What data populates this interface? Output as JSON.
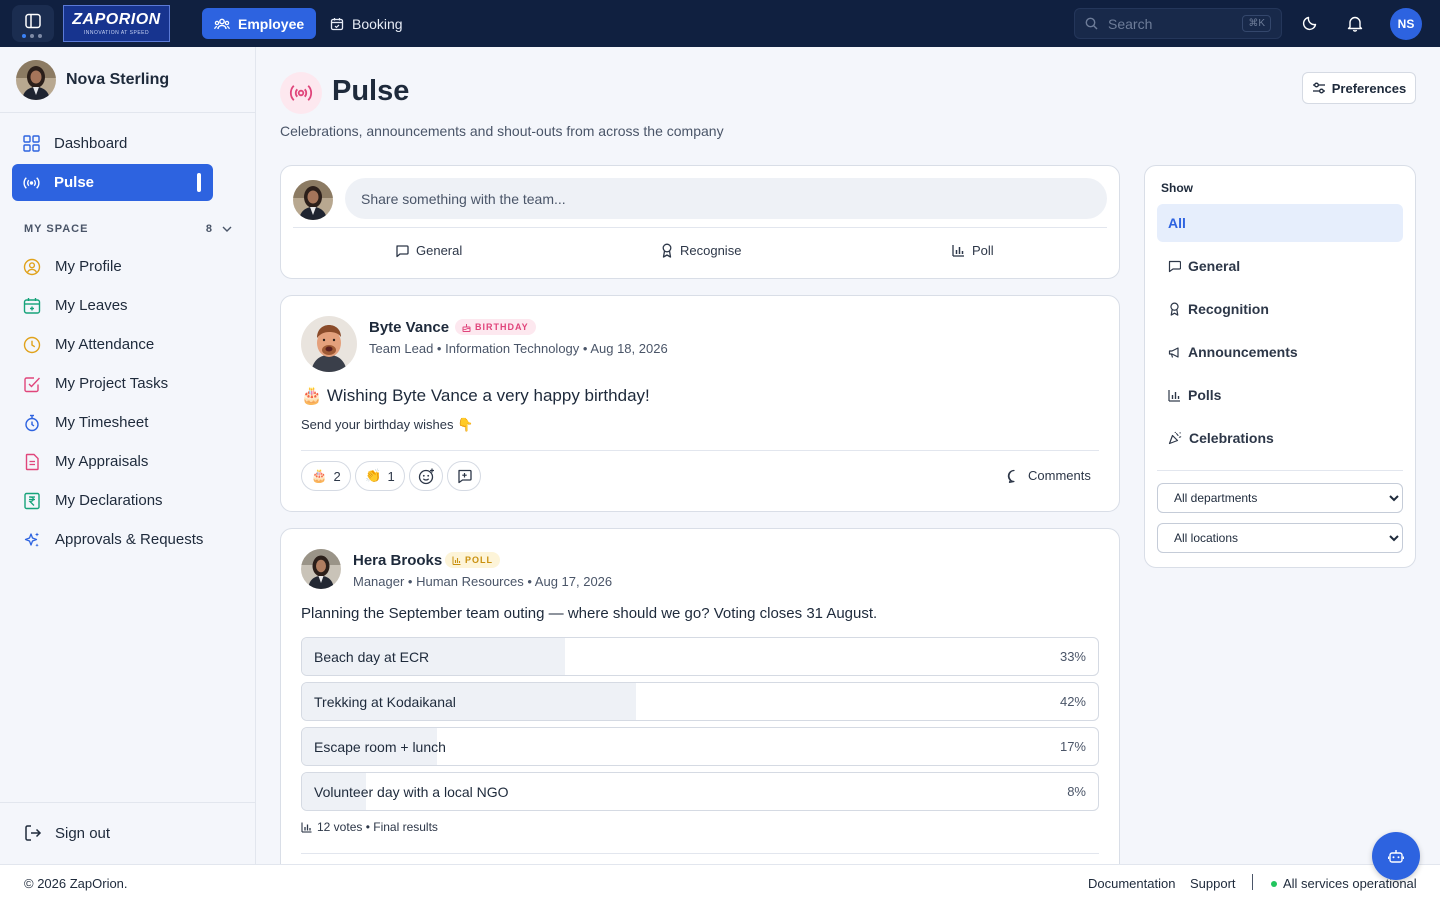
{
  "app": {
    "logo_text": "ZAPORION",
    "logo_tagline": "INNOVATION AT SPEED"
  },
  "topnav": {
    "tabs": [
      {
        "label": "Employee",
        "active": true,
        "icon": "users-icon"
      },
      {
        "label": "Booking",
        "active": false,
        "icon": "calendar-check-icon"
      }
    ],
    "search_placeholder": "Search",
    "search_shortcut": "⌘K",
    "user_initials": "NS"
  },
  "sidebar": {
    "user_name": "Nova Sterling",
    "top_items": [
      {
        "label": "Dashboard",
        "icon": "dashboard-icon",
        "active": false
      },
      {
        "label": "Pulse",
        "icon": "broadcast-icon",
        "active": true
      }
    ],
    "section_label": "MY SPACE",
    "section_count": "8",
    "items": [
      {
        "label": "My Profile",
        "icon": "user-circle-icon",
        "color": "#e0a21b"
      },
      {
        "label": "My Leaves",
        "icon": "calendar-plus-icon",
        "color": "#16a37a"
      },
      {
        "label": "My Attendance",
        "icon": "clock-icon",
        "color": "#e0a21b"
      },
      {
        "label": "My Project Tasks",
        "icon": "task-check-icon",
        "color": "#e0457b"
      },
      {
        "label": "My Timesheet",
        "icon": "stopwatch-icon",
        "color": "#2d63e0"
      },
      {
        "label": "My Appraisals",
        "icon": "document-icon",
        "color": "#e0457b"
      },
      {
        "label": "My Declarations",
        "icon": "rupee-icon",
        "color": "#16a37a"
      },
      {
        "label": "Approvals & Requests",
        "icon": "sparkles-icon",
        "color": "#2d63e0"
      }
    ],
    "signout_label": "Sign out"
  },
  "page": {
    "title": "Pulse",
    "subtitle": "Celebrations, announcements and shout-outs from across the company",
    "preferences_label": "Preferences"
  },
  "composer": {
    "placeholder": "Share something with the team...",
    "actions": [
      {
        "label": "General",
        "icon": "chat-icon"
      },
      {
        "label": "Recognise",
        "icon": "award-icon"
      },
      {
        "label": "Poll",
        "icon": "bar-chart-icon"
      }
    ]
  },
  "posts": [
    {
      "author": "Byte Vance",
      "badge": "BIRTHDAY",
      "meta": "Team Lead • Information Technology • Aug 18, 2026",
      "headline": "🎂 Wishing Byte Vance a very happy birthday!",
      "body": "Send your birthday wishes 👇",
      "reactions": [
        {
          "emoji": "🎂",
          "count": "2"
        },
        {
          "emoji": "👏",
          "count": "1"
        }
      ],
      "comments_label": "Comments"
    },
    {
      "author": "Hera Brooks",
      "badge": "POLL",
      "meta": "Manager • Human Resources • Aug 17, 2026",
      "question": "Planning the September team outing — where should we go? Voting closes 31 August.",
      "options": [
        {
          "label": "Beach day at ECR",
          "pct": "33%",
          "value": 33
        },
        {
          "label": "Trekking at Kodaikanal",
          "pct": "42%",
          "value": 42
        },
        {
          "label": "Escape room + lunch",
          "pct": "17%",
          "value": 17
        },
        {
          "label": "Volunteer day with a local NGO",
          "pct": "8%",
          "value": 8
        }
      ],
      "footer": "12 votes • Final results"
    }
  ],
  "filter": {
    "title": "Show",
    "items": [
      {
        "label": "All",
        "icon": "",
        "active": true
      },
      {
        "label": "General",
        "icon": "chat-icon",
        "active": false
      },
      {
        "label": "Recognition",
        "icon": "award-icon",
        "active": false
      },
      {
        "label": "Announcements",
        "icon": "megaphone-icon",
        "active": false
      },
      {
        "label": "Polls",
        "icon": "bar-chart-icon",
        "active": false
      },
      {
        "label": "Celebrations",
        "icon": "party-icon",
        "active": false
      }
    ],
    "department": "All departments",
    "location": "All locations"
  },
  "footer": {
    "copyright": "© 2026 ZapOrion.",
    "links": [
      "Documentation",
      "Support"
    ],
    "status": "All services operational"
  },
  "colors": {
    "primary": "#2d63e0",
    "topbar": "#102040",
    "birthday": "#e0457b",
    "poll": "#c9900e",
    "status_ok": "#22c55e"
  }
}
